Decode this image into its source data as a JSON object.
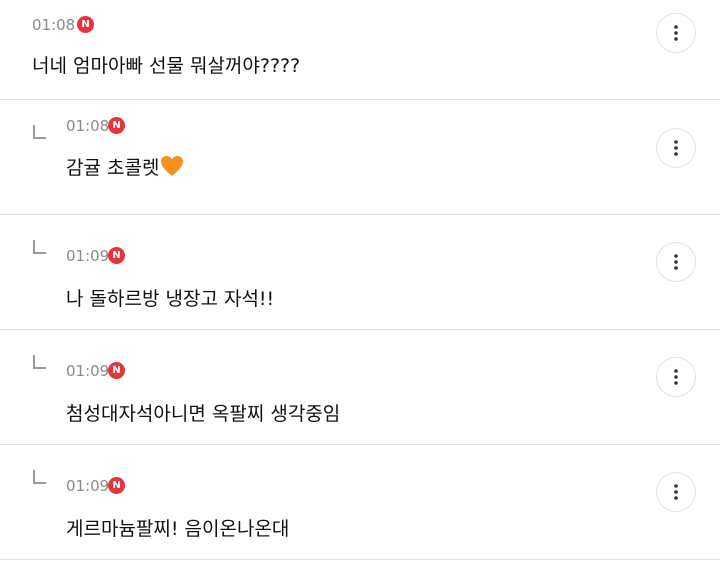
{
  "comments": [
    {
      "time": "01:08",
      "badge": "N",
      "text": "너네 엄마아빠 선물 뭐살꺼야????",
      "reply": false
    },
    {
      "time": "01:08",
      "badge": "N",
      "text": "감귤 초콜렛",
      "emoji": "orange-heart",
      "reply": true
    },
    {
      "time": "01:09",
      "badge": "N",
      "text": "나 돌하르방 냉장고 자석!!",
      "reply": true
    },
    {
      "time": "01:09",
      "badge": "N",
      "text": "첨성대자석아니면 옥팔찌 생각중임",
      "reply": true
    },
    {
      "time": "01:09",
      "badge": "N",
      "text": "게르마늄팔찌! 음이온나온대",
      "reply": true
    }
  ],
  "icons": {
    "more": "more-vertical-icon",
    "reply": "reply-arrow-icon",
    "new": "new-badge"
  },
  "colors": {
    "badge": "#e4343c",
    "time": "#8a8a8a",
    "divider": "#e3e3e3",
    "heart": "#f5901e"
  }
}
